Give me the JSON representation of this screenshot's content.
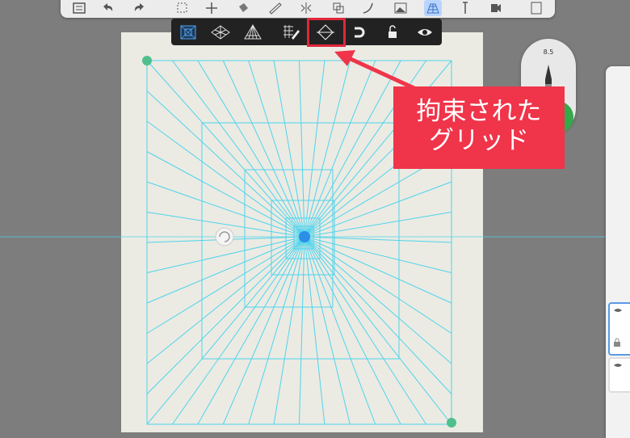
{
  "top_toolbar": {
    "icons": [
      "list-icon",
      "undo-icon",
      "redo-icon",
      "selection-icon",
      "transform-icon",
      "fill-icon",
      "ruler-icon",
      "symmetry-icon",
      "copy-icon",
      "curve-icon",
      "image-icon",
      "perspective-grid-icon",
      "text-icon",
      "video-icon",
      "panel-icon"
    ],
    "active": "perspective-grid-icon"
  },
  "grid_toolbar": {
    "buttons": [
      "one-point-perspective-icon",
      "two-point-perspective-icon",
      "three-point-perspective-icon",
      "draw-on-grid-icon",
      "constrained-grid-icon",
      "magnet-icon",
      "lock-icon",
      "visibility-icon"
    ],
    "highlighted": "constrained-grid-icon"
  },
  "brush_widget": {
    "size": "8.5"
  },
  "callout": {
    "line1": "拘束された",
    "line2": "グリッド"
  },
  "colors": {
    "grid": "#4fd3ec",
    "handle": "#4fc08d",
    "vanishing_point": "#2d8ee8",
    "callout": "#f0344a",
    "highlight": "#e0283a"
  }
}
